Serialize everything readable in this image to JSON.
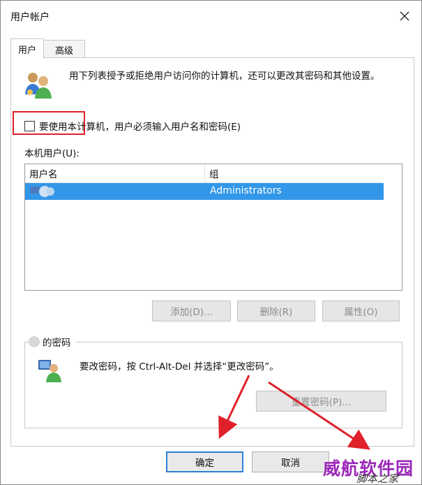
{
  "window": {
    "title": "用户帐户"
  },
  "tabs": [
    {
      "label": "用户",
      "active": true
    },
    {
      "label": "高级",
      "active": false
    }
  ],
  "intro_text": "用下列表授予或拒绝用户访问你的计算机，还可以更改其密码和其他设置。",
  "checkbox": {
    "label": "要使用本计算机，用户必须输入用户名和密码(E)",
    "checked": false
  },
  "users_section": {
    "label": "本机用户(U):",
    "columns": [
      "用户名",
      "组"
    ],
    "rows": [
      {
        "user": "",
        "group": "Administrators",
        "selected": true
      }
    ]
  },
  "list_buttons": {
    "add": "添加(D)...",
    "remove": "删除(R)",
    "properties": "属性(O)"
  },
  "password_section": {
    "title": "的密码",
    "text": "要改密码，按 Ctrl-Alt-Del 并选择“更改密码”。",
    "reset_button": "重置密码(P)..."
  },
  "footer": {
    "ok": "确定",
    "cancel": "取消"
  },
  "watermark": {
    "main": "威航软件园",
    "sub": "脚本之家"
  },
  "colors": {
    "selection": "#3297e8",
    "annotation_red": "#e0202a",
    "primary_border": "#2f7fd2",
    "watermark_purple": "#9b27b8"
  },
  "icons": {
    "close": "close-icon",
    "users": "users-icon",
    "user_avatar": "user-avatar-icon",
    "key_user": "user-password-icon"
  }
}
